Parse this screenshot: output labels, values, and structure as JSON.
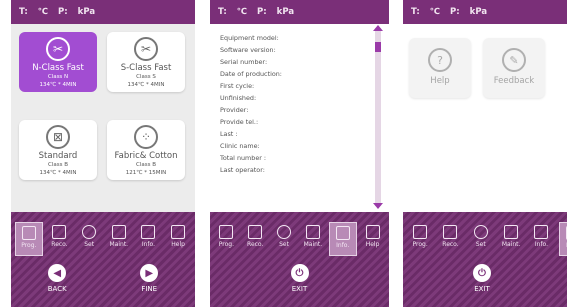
{
  "status": {
    "t_label": "T:",
    "unit_c": "℃",
    "p_label": "P:",
    "unit_p": "kPa"
  },
  "tabs": [
    {
      "label": "Prog."
    },
    {
      "label": "Reco."
    },
    {
      "label": "Set"
    },
    {
      "label": "Maint."
    },
    {
      "label": "Info."
    },
    {
      "label": "Help"
    }
  ],
  "programs": [
    {
      "name": "N-Class Fast",
      "class": "Class N",
      "spec": "134℃ * 4MIN"
    },
    {
      "name": "S-Class Fast",
      "class": "Class S",
      "spec": "134℃ * 4MIN"
    },
    {
      "name": "Standard",
      "class": "Class B",
      "spec": "134℃ * 4MIN"
    },
    {
      "name": "Fabric& Cotton",
      "class": "Class B",
      "spec": "121℃ * 15MIN"
    }
  ],
  "buttons": {
    "back": "BACK",
    "fine": "FINE",
    "exit": "EXIT"
  },
  "info": [
    "Equipment model:",
    "Software version:",
    "Serial number:",
    "Date of production:",
    "First cycle:",
    "Unfinished:",
    "Provider:",
    "Provide tel.:",
    "Last :",
    "Clinic name:",
    "Total number :",
    "Last operator:"
  ],
  "help_tiles": [
    {
      "label": "Help"
    },
    {
      "label": "Feedback"
    }
  ],
  "colors": {
    "purple": "#7a2f78",
    "active_card": "#a24dd2"
  }
}
